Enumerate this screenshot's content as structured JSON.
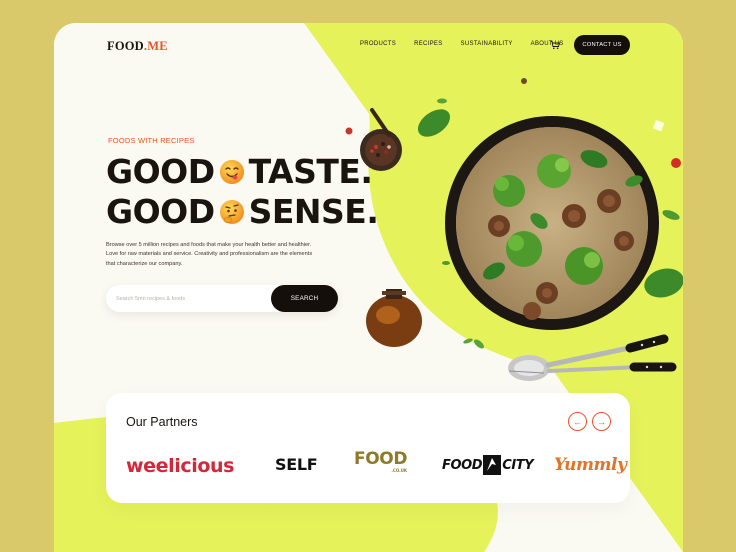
{
  "brand": {
    "name": "FOOD",
    "suffix": ".ME"
  },
  "nav": {
    "items": [
      "PRODUCTS",
      "RECIPES",
      "SUSTAINABILITY",
      "ABOUT US"
    ],
    "contact_label": "CONTACT US"
  },
  "hero": {
    "eyebrow": "FOODS WITH RECIPES",
    "line1_a": "GOOD",
    "line1_b": "TASTE.",
    "line2_a": "GOOD",
    "line2_b": "SENSE.",
    "description": "Browse over 5 million recipes and foods that make your health better and healthier. Love for raw materials and service. Creativity and professionalism are the elements that characterize our company."
  },
  "search": {
    "placeholder": "Search 5mn recipes & foods",
    "value": "",
    "button_label": "SEARCH"
  },
  "partners": {
    "title": "Our Partners",
    "logos": [
      "weelicious",
      "SELF",
      "FOOD",
      "FOOD",
      "CITY",
      "Yummly"
    ],
    "food_sub": ".CO.UK"
  },
  "colors": {
    "accent": "#e8532b",
    "lime": "#e6f25a",
    "dark": "#150f0c",
    "page_bg": "#d9c96a"
  },
  "icons": [
    "cart-icon",
    "smiling-emoji-icon",
    "thinking-emoji-icon",
    "arrow-left-icon",
    "arrow-right-icon"
  ]
}
